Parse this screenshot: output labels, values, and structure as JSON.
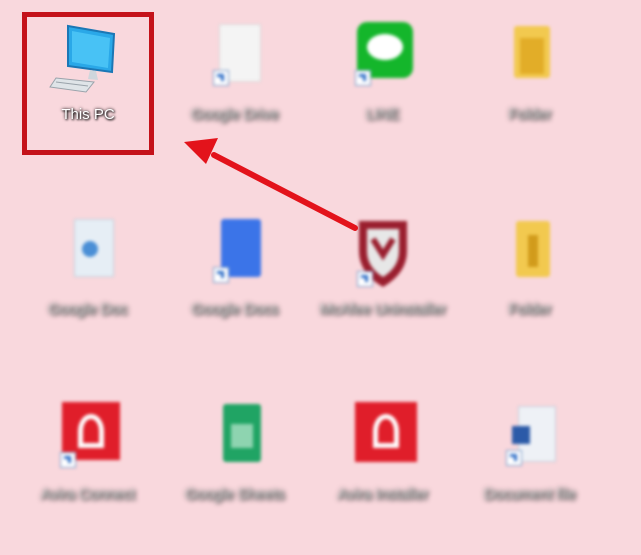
{
  "desktop": {
    "background": "#f9d8dd",
    "highlight_color": "#c4121a",
    "icons": [
      {
        "label": "This PC",
        "icon": "this-pc-icon"
      },
      {
        "label": "Google Drive",
        "icon": "document-file-icon"
      },
      {
        "label": "LINE",
        "icon": "line-app-icon"
      },
      {
        "label": "Folder",
        "icon": "folder-icon"
      },
      {
        "label": "Google Doc",
        "icon": "generic-file-icon"
      },
      {
        "label": "Google Docs",
        "icon": "google-docs-icon"
      },
      {
        "label": "McAfee Uninstaller",
        "icon": "mcafee-shield-icon"
      },
      {
        "label": "Folder",
        "icon": "folder-icon"
      },
      {
        "label": "Avira Connect",
        "icon": "avira-icon"
      },
      {
        "label": "Google Sheets",
        "icon": "google-sheets-icon"
      },
      {
        "label": "Avira Installer",
        "icon": "avira-icon"
      },
      {
        "label": "Document file",
        "icon": "word-document-icon"
      }
    ]
  }
}
